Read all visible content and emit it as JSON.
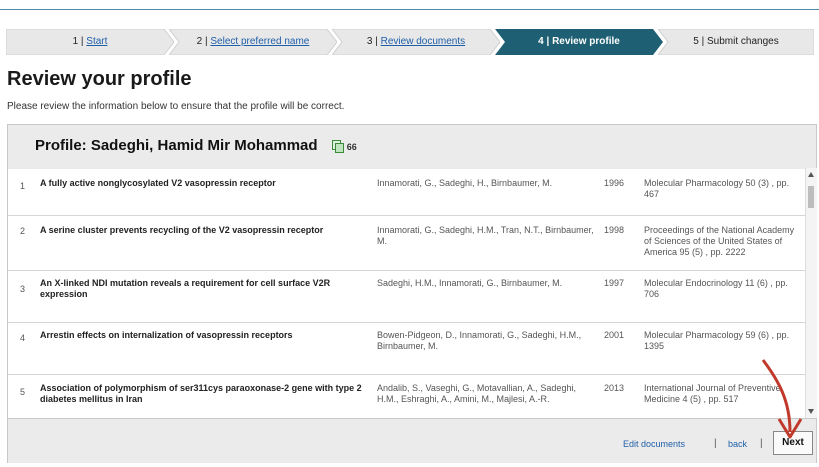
{
  "steps": [
    {
      "num": "1",
      "label": "Start",
      "link": true
    },
    {
      "num": "2",
      "label": "Select preferred name",
      "link": true
    },
    {
      "num": "3",
      "label": "Review documents",
      "link": true
    },
    {
      "num": "4",
      "label": "Review profile",
      "link": false,
      "active": true
    },
    {
      "num": "5",
      "label": "Submit changes",
      "link": false
    }
  ],
  "sep": "|",
  "page": {
    "title": "Review your profile",
    "subtitle": "Please review the information below to ensure that the profile will be correct."
  },
  "profile": {
    "title": "Profile: Sadeghi, Hamid Mir Mohammad",
    "count": "66",
    "icon": "copy-icon"
  },
  "documents": [
    {
      "num": "1",
      "title": "A fully active nonglycosylated V2 vasopressin receptor",
      "authors": "Innamorati, G., Sadeghi, H., Birnbaumer, M.",
      "year": "1996",
      "journal": "Molecular Pharmacology 50 (3) , pp. 467"
    },
    {
      "num": "2",
      "title": "A serine cluster prevents recycling of the V2 vasopressin receptor",
      "authors": "Innamorati, G., Sadeghi, H.M., Tran, N.T., Birnbaumer, M.",
      "year": "1998",
      "journal": "Proceedings of the National Academy of Sciences of the United States of America 95 (5) , pp. 2222"
    },
    {
      "num": "3",
      "title": "An X-linked NDI mutation reveals a requirement for cell surface V2R expression",
      "authors": "Sadeghi, H.M., Innamorati, G., Birnbaumer, M.",
      "year": "1997",
      "journal": "Molecular Endocrinology 11 (6) , pp. 706"
    },
    {
      "num": "4",
      "title": "Arrestin effects on internalization of vasopressin receptors",
      "authors": "Bowen-Pidgeon, D., Innamorati, G., Sadeghi, H.M., Birnbaumer, M.",
      "year": "2001",
      "journal": "Molecular Pharmacology 59 (6) , pp. 1395"
    },
    {
      "num": "5",
      "title": "Association of polymorphism of ser311cys paraoxonase-2 gene with type 2 diabetes mellitus in Iran",
      "authors": "Andalib, S., Vaseghi, G., Motavallian, A., Sadeghi, H.M., Eshraghi, A., Amini, M., Majlesi, A.-R.",
      "year": "2013",
      "journal": "International Journal of Preventive Medicine 4 (5) , pp. 517"
    }
  ],
  "footer": {
    "edit_label": "Edit documents",
    "back_label": "back",
    "sep": "|",
    "next_label": "Next"
  },
  "colors": {
    "active_step": "#1f5f73",
    "inactive_step": "#e8e8e8",
    "link": "#1f5fa8",
    "annotation_arrow": "#c0392b"
  }
}
